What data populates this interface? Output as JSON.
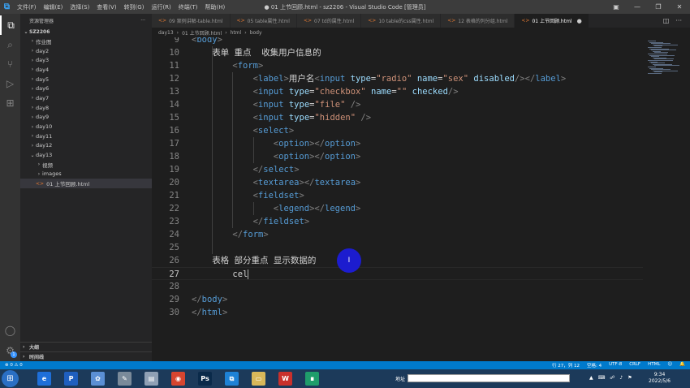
{
  "titlebar": {
    "menu": [
      "文件(F)",
      "编辑(E)",
      "选择(S)",
      "查看(V)",
      "转到(G)",
      "运行(R)",
      "终端(T)",
      "帮助(H)"
    ],
    "title": "● 01 上节回顾.html - sz2206 - Visual Studio Code [管理员]",
    "minimize": "—",
    "restore": "❐",
    "close": "✕"
  },
  "sidebar": {
    "header": "资源管理器",
    "more": "···",
    "root": "SZ2206",
    "items": [
      {
        "label": "作业图",
        "type": "folder",
        "expanded": false
      },
      {
        "label": "day2",
        "type": "folder",
        "expanded": false
      },
      {
        "label": "day3",
        "type": "folder",
        "expanded": false
      },
      {
        "label": "day4",
        "type": "folder",
        "expanded": false
      },
      {
        "label": "day5",
        "type": "folder",
        "expanded": false
      },
      {
        "label": "day6",
        "type": "folder",
        "expanded": false
      },
      {
        "label": "day7",
        "type": "folder",
        "expanded": false
      },
      {
        "label": "day8",
        "type": "folder",
        "expanded": false
      },
      {
        "label": "day9",
        "type": "folder",
        "expanded": false
      },
      {
        "label": "day10",
        "type": "folder",
        "expanded": false
      },
      {
        "label": "day11",
        "type": "folder",
        "expanded": false
      },
      {
        "label": "day12",
        "type": "folder",
        "expanded": false
      },
      {
        "label": "day13",
        "type": "folder",
        "expanded": true
      },
      {
        "label": "视频",
        "type": "folder",
        "expanded": false
      },
      {
        "label": "images",
        "type": "folder",
        "expanded": false
      },
      {
        "label": "01 上节回顾.html",
        "type": "file",
        "active": true
      }
    ],
    "outline": "大纲",
    "timeline": "时间线"
  },
  "tabs": [
    {
      "label": "09 案例讲解-table.html",
      "active": false
    },
    {
      "label": "05 table属性.html",
      "active": false
    },
    {
      "label": "07 td的属性.html",
      "active": false
    },
    {
      "label": "10 table的css属性.html",
      "active": false
    },
    {
      "label": "12 表格的列分组.html",
      "active": false
    },
    {
      "label": "01 上节回顾.html",
      "active": true,
      "dirty": "●"
    }
  ],
  "breadcrumb": [
    "day13",
    "01 上节回顾.html",
    "html",
    "body"
  ],
  "editor": {
    "current_line": 27,
    "lines": [
      {
        "n": "9",
        "indent": 0,
        "parts": [
          [
            "brk",
            "<"
          ],
          [
            "tag",
            "body"
          ],
          [
            "brk",
            ">"
          ]
        ]
      },
      {
        "n": "10",
        "indent": 1,
        "parts": [
          [
            "txt",
            "表单 重点  收集用户信息的"
          ]
        ]
      },
      {
        "n": "11",
        "indent": 2,
        "parts": [
          [
            "brk",
            "<"
          ],
          [
            "tag",
            "form"
          ],
          [
            "brk",
            ">"
          ]
        ]
      },
      {
        "n": "12",
        "indent": 3,
        "parts": [
          [
            "brk",
            "<"
          ],
          [
            "tag",
            "label"
          ],
          [
            "brk",
            ">"
          ],
          [
            "txt",
            "用户名"
          ],
          [
            "brk",
            "<"
          ],
          [
            "tag",
            "input"
          ],
          [
            "txt",
            " "
          ],
          [
            "attr",
            "type"
          ],
          [
            "txt",
            "="
          ],
          [
            "str",
            "\"radio\""
          ],
          [
            "txt",
            " "
          ],
          [
            "attr",
            "name"
          ],
          [
            "txt",
            "="
          ],
          [
            "str",
            "\"sex\""
          ],
          [
            "txt",
            " "
          ],
          [
            "attr",
            "disabled"
          ],
          [
            "brk",
            "/></"
          ],
          [
            "tag",
            "label"
          ],
          [
            "brk",
            ">"
          ]
        ]
      },
      {
        "n": "13",
        "indent": 3,
        "parts": [
          [
            "brk",
            "<"
          ],
          [
            "tag",
            "input"
          ],
          [
            "txt",
            " "
          ],
          [
            "attr",
            "type"
          ],
          [
            "txt",
            "="
          ],
          [
            "str",
            "\"checkbox\""
          ],
          [
            "txt",
            " "
          ],
          [
            "attr",
            "name"
          ],
          [
            "txt",
            "="
          ],
          [
            "str",
            "\"\""
          ],
          [
            "txt",
            " "
          ],
          [
            "attr",
            "checked"
          ],
          [
            "brk",
            "/>"
          ]
        ]
      },
      {
        "n": "14",
        "indent": 3,
        "parts": [
          [
            "brk",
            "<"
          ],
          [
            "tag",
            "input"
          ],
          [
            "txt",
            " "
          ],
          [
            "attr",
            "type"
          ],
          [
            "txt",
            "="
          ],
          [
            "str",
            "\"file\""
          ],
          [
            "txt",
            " "
          ],
          [
            "brk",
            "/>"
          ]
        ]
      },
      {
        "n": "15",
        "indent": 3,
        "parts": [
          [
            "brk",
            "<"
          ],
          [
            "tag",
            "input"
          ],
          [
            "txt",
            " "
          ],
          [
            "attr",
            "type"
          ],
          [
            "txt",
            "="
          ],
          [
            "str",
            "\"hidden\""
          ],
          [
            "txt",
            " "
          ],
          [
            "brk",
            "/>"
          ]
        ]
      },
      {
        "n": "16",
        "indent": 3,
        "parts": [
          [
            "brk",
            "<"
          ],
          [
            "tag",
            "select"
          ],
          [
            "brk",
            ">"
          ]
        ]
      },
      {
        "n": "17",
        "indent": 4,
        "parts": [
          [
            "brk",
            "<"
          ],
          [
            "tag",
            "option"
          ],
          [
            "brk",
            "></"
          ],
          [
            "tag",
            "option"
          ],
          [
            "brk",
            ">"
          ]
        ]
      },
      {
        "n": "18",
        "indent": 4,
        "parts": [
          [
            "brk",
            "<"
          ],
          [
            "tag",
            "option"
          ],
          [
            "brk",
            "></"
          ],
          [
            "tag",
            "option"
          ],
          [
            "brk",
            ">"
          ]
        ]
      },
      {
        "n": "19",
        "indent": 3,
        "parts": [
          [
            "brk",
            "</"
          ],
          [
            "tag",
            "select"
          ],
          [
            "brk",
            ">"
          ]
        ]
      },
      {
        "n": "20",
        "indent": 3,
        "parts": [
          [
            "brk",
            "<"
          ],
          [
            "tag",
            "textarea"
          ],
          [
            "brk",
            "></"
          ],
          [
            "tag",
            "textarea"
          ],
          [
            "brk",
            ">"
          ]
        ]
      },
      {
        "n": "21",
        "indent": 3,
        "parts": [
          [
            "brk",
            "<"
          ],
          [
            "tag",
            "fieldset"
          ],
          [
            "brk",
            ">"
          ]
        ]
      },
      {
        "n": "22",
        "indent": 4,
        "parts": [
          [
            "brk",
            "<"
          ],
          [
            "tag",
            "legend"
          ],
          [
            "brk",
            "></"
          ],
          [
            "tag",
            "legend"
          ],
          [
            "brk",
            ">"
          ]
        ]
      },
      {
        "n": "23",
        "indent": 3,
        "parts": [
          [
            "brk",
            "</"
          ],
          [
            "tag",
            "fieldset"
          ],
          [
            "brk",
            ">"
          ]
        ]
      },
      {
        "n": "24",
        "indent": 2,
        "parts": [
          [
            "brk",
            "</"
          ],
          [
            "tag",
            "form"
          ],
          [
            "brk",
            ">"
          ]
        ]
      },
      {
        "n": "25",
        "indent": 0,
        "parts": []
      },
      {
        "n": "26",
        "indent": 1,
        "parts": [
          [
            "txt",
            "表格 部分重点 显示数据的"
          ]
        ]
      },
      {
        "n": "27",
        "indent": 2,
        "parts": [
          [
            "txt",
            "cel"
          ]
        ],
        "cursor": true
      },
      {
        "n": "28",
        "indent": 0,
        "parts": []
      },
      {
        "n": "29",
        "indent": 0,
        "parts": [
          [
            "brk",
            "</"
          ],
          [
            "tag",
            "body"
          ],
          [
            "brk",
            ">"
          ]
        ]
      },
      {
        "n": "30",
        "indent": 0,
        "parts": [
          [
            "brk",
            "</"
          ],
          [
            "tag",
            "html"
          ],
          [
            "brk",
            ">"
          ]
        ]
      }
    ],
    "pointer_label": "I"
  },
  "statusbar": {
    "left": "⊗ 0 ⚠ 0",
    "position": "行 27，列 12",
    "spaces": "空格: 4",
    "encoding": "UTF-8",
    "eol": "CRLF",
    "language": "HTML",
    "feedback": "☺",
    "bell": "🔔"
  },
  "taskbar": {
    "address_label": "地址",
    "time": "9:34",
    "date": "2022/5/6",
    "apps": [
      {
        "name": "ie-icon",
        "glyph": "e",
        "color": "#1e6fd9"
      },
      {
        "name": "paint-p-icon",
        "glyph": "P",
        "color": "#1f5fbf"
      },
      {
        "name": "network-icon",
        "glyph": "✿",
        "color": "#5b8fd4"
      },
      {
        "name": "tools-icon",
        "glyph": "✎",
        "color": "#7a8a9a"
      },
      {
        "name": "document-icon",
        "glyph": "▤",
        "color": "#8fa0b5"
      },
      {
        "name": "chrome-icon",
        "glyph": "◉",
        "color": "#d6452f"
      },
      {
        "name": "photoshop-icon",
        "glyph": "Ps",
        "color": "#0a2a4a"
      },
      {
        "name": "vscode-icon",
        "glyph": "⧉",
        "color": "#1e82d6"
      },
      {
        "name": "folder-icon",
        "glyph": "▭",
        "color": "#d8b85a"
      },
      {
        "name": "wps-icon",
        "glyph": "W",
        "color": "#c9302c"
      },
      {
        "name": "notes-icon",
        "glyph": "∎",
        "color": "#1f9d6b"
      }
    ]
  }
}
